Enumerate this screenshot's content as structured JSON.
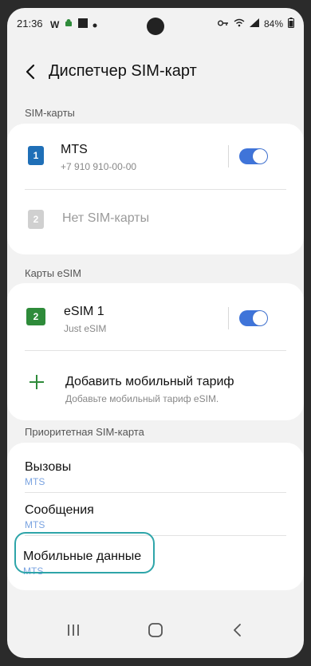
{
  "status_bar": {
    "time": "21:36",
    "battery": "84%",
    "left_icons": [
      "w-icon",
      "android-icon",
      "square-icon",
      "dot-icon"
    ],
    "right_icons": [
      "key-icon",
      "wifi-icon",
      "signal-icon"
    ]
  },
  "header": {
    "title": "Диспетчер SIM-карт"
  },
  "sections": {
    "sim_cards_label": "SIM-карты",
    "esim_label": "Карты eSIM",
    "priority_label": "Приоритетная SIM-карта"
  },
  "sim_cards": [
    {
      "slot": "1",
      "name": "MTS",
      "number": "+7 910 910-00-00",
      "enabled": true
    },
    {
      "slot": "2",
      "name": "Нет SIM-карты"
    }
  ],
  "esim": {
    "slot": "2",
    "name": "eSIM 1",
    "sub": "Just eSIM",
    "enabled": true,
    "add_title": "Добавить мобильный тариф",
    "add_sub": "Добавьте мобильный тариф eSIM."
  },
  "priority": [
    {
      "title": "Вызовы",
      "value": "MTS"
    },
    {
      "title": "Сообщения",
      "value": "MTS"
    },
    {
      "title": "Мобильные данные",
      "value": "MTS"
    }
  ],
  "colors": {
    "accent": "#3f74d9",
    "sim_blue": "#1f6fb7",
    "esim_green": "#2e8b3a",
    "highlight": "#2ea5a9",
    "value_blue": "#7ba4e1"
  }
}
